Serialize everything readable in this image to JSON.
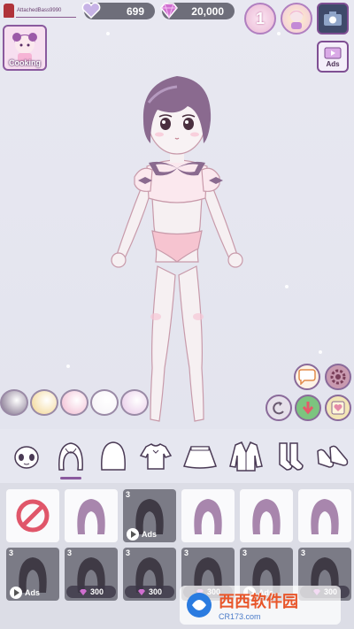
{
  "player": {
    "name": "AttachedBass9990"
  },
  "currency": {
    "hearts": "699",
    "gems": "20,000"
  },
  "badges": {
    "rank": "1"
  },
  "ads_button": {
    "label": "Ads"
  },
  "cooking_button": {
    "label": "Cooking"
  },
  "swatch_colors": [
    "#7a6a86",
    "#f2d48c",
    "#f1b8cf",
    "#f5f2f6",
    "#e7c6e6"
  ],
  "categories": [
    {
      "name": "face",
      "icon": "face-icon"
    },
    {
      "name": "hair-front",
      "icon": "hair-front-icon",
      "active": true
    },
    {
      "name": "hair-back",
      "icon": "hair-back-icon"
    },
    {
      "name": "tops",
      "icon": "blouse-icon"
    },
    {
      "name": "skirts",
      "icon": "skirt-icon"
    },
    {
      "name": "jackets",
      "icon": "jacket-icon"
    },
    {
      "name": "socks",
      "icon": "socks-icon"
    },
    {
      "name": "shoes",
      "icon": "shoes-icon"
    }
  ],
  "items": [
    {
      "type": "none",
      "icon": "none-icon"
    },
    {
      "type": "free"
    },
    {
      "type": "ad",
      "count": "3",
      "label": "Ads"
    },
    {
      "type": "free"
    },
    {
      "type": "free"
    },
    {
      "type": "free"
    },
    {
      "type": "ad",
      "count": "3",
      "label": "Ads"
    },
    {
      "type": "gem",
      "count": "3",
      "price": "300"
    },
    {
      "type": "gem",
      "count": "3",
      "price": "300"
    },
    {
      "type": "gem",
      "count": "3",
      "price": "300"
    },
    {
      "type": "ad",
      "count": "3",
      "label": "Ads"
    },
    {
      "type": "gem",
      "count": "3",
      "price": "300"
    }
  ],
  "watermark": {
    "title": "西西软件园",
    "url": "CR173.com"
  }
}
